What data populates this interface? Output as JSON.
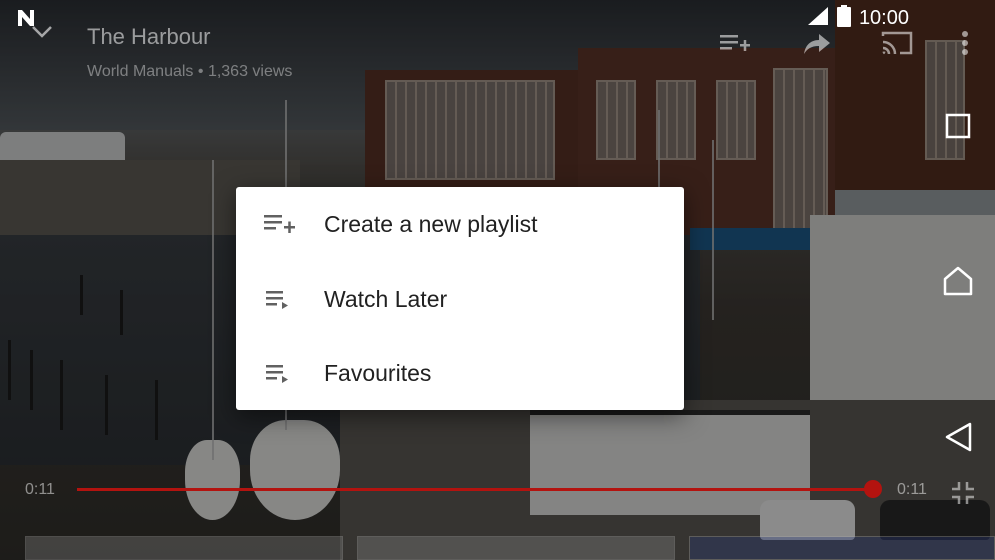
{
  "video": {
    "title": "The Harbour",
    "channel": "World Manuals",
    "separator": "•",
    "views": "1,363 views",
    "current_time": "0:11",
    "total_time": "0:11",
    "progress": 1.0
  },
  "status_bar": {
    "time": "10:00",
    "icons": [
      "notification-n-icon",
      "signal-icon",
      "battery-icon"
    ]
  },
  "top_actions": [
    "add-to-playlist-icon",
    "share-icon",
    "cast-icon",
    "more-vert-icon"
  ],
  "nav_bar": [
    "recents-icon",
    "home-icon",
    "back-icon"
  ],
  "playlist_dialog": {
    "items": [
      {
        "label": "Create a new playlist",
        "icon": "playlist-add-icon"
      },
      {
        "label": "Watch Later",
        "icon": "playlist-play-icon"
      },
      {
        "label": "Favourites",
        "icon": "playlist-play-icon"
      }
    ]
  },
  "colors": {
    "accent": "#b3130f",
    "dialog_bg": "#ffffff",
    "dialog_text": "#212121"
  }
}
